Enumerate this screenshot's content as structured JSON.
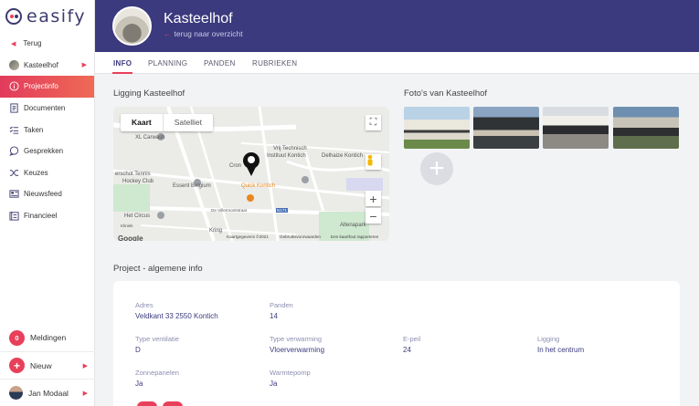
{
  "app": {
    "logo_text": "easify"
  },
  "sidebar": {
    "back_label": "Terug",
    "project_label": "Kasteelhof",
    "items": [
      {
        "label": "Projectinfo",
        "icon": "info-icon",
        "active": true
      },
      {
        "label": "Documenten",
        "icon": "document-icon",
        "active": false
      },
      {
        "label": "Taken",
        "icon": "tasks-icon",
        "active": false
      },
      {
        "label": "Gesprekken",
        "icon": "chat-icon",
        "active": false
      },
      {
        "label": "Keuzes",
        "icon": "shuffle-icon",
        "active": false
      },
      {
        "label": "Nieuwsfeed",
        "icon": "newsfeed-icon",
        "active": false
      },
      {
        "label": "Financieel",
        "icon": "finance-icon",
        "active": false
      }
    ],
    "notifications": {
      "count": "0",
      "label": "Meldingen"
    },
    "new_label": "Nieuw",
    "user_name": "Jan Modaal"
  },
  "header": {
    "title": "Kasteelhof",
    "back_link": "terug naar overzicht"
  },
  "tabs": [
    {
      "label": "INFO",
      "active": true
    },
    {
      "label": "PLANNING",
      "active": false
    },
    {
      "label": "PANDEN",
      "active": false
    },
    {
      "label": "RUBRIEKEN",
      "active": false
    }
  ],
  "location": {
    "title": "Ligging Kasteelhof",
    "map_toggle": {
      "map": "Kaart",
      "satellite": "Satelliet"
    },
    "map_labels": [
      "XL Carwash",
      "Vrij Technisch",
      "Instituut Kontich",
      "erschot Tennis",
      "Hockey Club",
      "Essent Belgium",
      "Quick Kontich",
      "Delhaize Kontich",
      "Het Circus",
      "Cron",
      "De Villermontstraat",
      "N171",
      "Altenapark",
      "Kring",
      "Kliniek"
    ],
    "map_footer": {
      "data": "Kaartgegevens ©2021",
      "terms": "Gebruiksvoorwaarden",
      "report": "Een kaartfout rapporteren",
      "brand": "Google"
    }
  },
  "photos": {
    "title": "Foto's van Kasteelhof"
  },
  "general": {
    "title": "Project - algemene info",
    "fields": [
      {
        "label": "Adres",
        "value": "Veldkant 33 2550 Kontich"
      },
      {
        "label": "Panden",
        "value": "14"
      },
      {
        "label": "Type ventilatie",
        "value": "D"
      },
      {
        "label": "Type verwarming",
        "value": "Vloerverwarming"
      },
      {
        "label": "E-peil",
        "value": "24"
      },
      {
        "label": "Ligging",
        "value": "In het centrum"
      },
      {
        "label": "Zonnepanelen",
        "value": "Ja"
      },
      {
        "label": "Warmtepomp",
        "value": "Ja"
      }
    ]
  },
  "colors": {
    "brand": "#3b3a7e",
    "accent": "#e8405a"
  }
}
